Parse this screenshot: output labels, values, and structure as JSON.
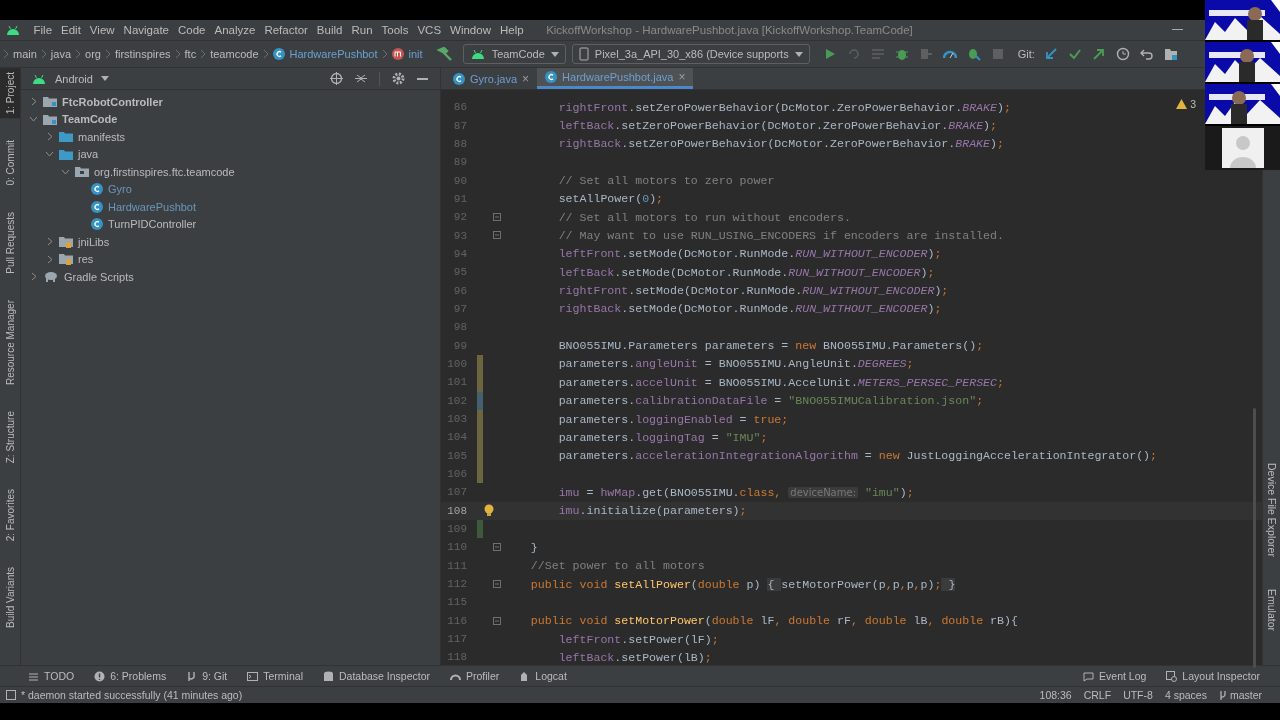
{
  "menu": [
    "File",
    "Edit",
    "View",
    "Navigate",
    "Code",
    "Analyze",
    "Refactor",
    "Build",
    "Run",
    "Tools",
    "VCS",
    "Window",
    "Help"
  ],
  "window": {
    "title": "KickoffWorkshop - HardwarePushbot.java [KickoffWorkshop.TeamCode]"
  },
  "breadcrumbs": [
    {
      "kind": "folder",
      "label": "main"
    },
    {
      "kind": "folder",
      "label": "java"
    },
    {
      "kind": "folder",
      "label": "org"
    },
    {
      "kind": "folder",
      "label": "firstinspires"
    },
    {
      "kind": "folder",
      "label": "ftc"
    },
    {
      "kind": "folder",
      "label": "teamcode"
    },
    {
      "kind": "class",
      "label": "HardwarePushbot"
    },
    {
      "kind": "method",
      "label": "init"
    }
  ],
  "run_config": "TeamCode",
  "device": "Pixel_3a_API_30_x86 (Device supports",
  "git_label": "Git:",
  "left_stripe": [
    {
      "label": "1: Project",
      "selected": true
    },
    {
      "label": "0: Commit",
      "selected": false
    },
    {
      "label": "Pull Requests",
      "selected": false
    },
    {
      "label": "Resource Manager",
      "selected": false
    },
    {
      "label": "Z: Structure",
      "selected": false
    },
    {
      "label": "2: Favorites",
      "selected": false
    },
    {
      "label": "Build Variants",
      "selected": false
    }
  ],
  "right_stripe": [
    "Device File Explorer",
    "Emulator"
  ],
  "project": {
    "view": "Android",
    "tree": [
      {
        "label": "FtcRobotController",
        "kind": "module",
        "expanded": false
      },
      {
        "label": "TeamCode",
        "kind": "module",
        "expanded": true,
        "children": [
          {
            "label": "manifests",
            "kind": "folder",
            "expanded": false
          },
          {
            "label": "java",
            "kind": "folder",
            "expanded": true,
            "children": [
              {
                "label": "org.firstinspires.ftc.teamcode",
                "kind": "package",
                "expanded": true,
                "children": [
                  {
                    "label": "Gyro",
                    "kind": "class",
                    "modified": true
                  },
                  {
                    "label": "HardwarePushbot",
                    "kind": "class",
                    "modified": true
                  },
                  {
                    "label": "TurnPIDController",
                    "kind": "class",
                    "modified": false
                  }
                ]
              }
            ]
          },
          {
            "label": "jniLibs",
            "kind": "resfolder",
            "expanded": false
          },
          {
            "label": "res",
            "kind": "resfolder",
            "expanded": false
          }
        ]
      },
      {
        "label": "Gradle Scripts",
        "kind": "gradle",
        "expanded": false
      }
    ]
  },
  "tabs": [
    {
      "label": "Gyro.java",
      "close": "×",
      "selected": false
    },
    {
      "label": "HardwarePushbot.java",
      "close": "×",
      "selected": true
    }
  ],
  "warnings": "3",
  "code": [
    {
      "number": "86",
      "tokens": [
        {
          "kind": "field",
          "text": "        rightFront"
        },
        {
          "kind": "plain",
          "text": ".setZeroPowerBehavior(DcMotor.ZeroPowerBehavior."
        },
        {
          "kind": "constant",
          "text": "BRAKE"
        },
        {
          "kind": "plain",
          "text": ")"
        },
        {
          "kind": "keyword",
          "text": ";"
        }
      ]
    },
    {
      "number": "87",
      "tokens": [
        {
          "kind": "field",
          "text": "        leftBack"
        },
        {
          "kind": "plain",
          "text": ".setZeroPowerBehavior(DcMotor.ZeroPowerBehavior."
        },
        {
          "kind": "constant",
          "text": "BRAKE"
        },
        {
          "kind": "plain",
          "text": ")"
        },
        {
          "kind": "keyword",
          "text": ";"
        }
      ]
    },
    {
      "number": "88",
      "tokens": [
        {
          "kind": "field",
          "text": "        rightBack"
        },
        {
          "kind": "plain",
          "text": ".setZeroPowerBehavior(DcMotor.ZeroPowerBehavior."
        },
        {
          "kind": "constant",
          "text": "BRAKE"
        },
        {
          "kind": "plain",
          "text": ")"
        },
        {
          "kind": "keyword",
          "text": ";"
        }
      ]
    },
    {
      "number": "89"
    },
    {
      "number": "90",
      "tokens": [
        {
          "kind": "comment",
          "text": "        // Set all motors to zero power"
        }
      ]
    },
    {
      "number": "91",
      "tokens": [
        {
          "kind": "plain",
          "text": "        setAllPower("
        },
        {
          "kind": "number",
          "text": "0"
        },
        {
          "kind": "plain",
          "text": ")"
        },
        {
          "kind": "keyword",
          "text": ";"
        }
      ]
    },
    {
      "number": "92",
      "fold": true,
      "tokens": [
        {
          "kind": "comment",
          "text": "        // Set all motors to run without encoders."
        }
      ]
    },
    {
      "number": "93",
      "fold": true,
      "tokens": [
        {
          "kind": "comment",
          "text": "        // May want to use RUN_USING_ENCODERS if encoders are installed."
        }
      ]
    },
    {
      "number": "94",
      "tokens": [
        {
          "kind": "field",
          "text": "        leftFront"
        },
        {
          "kind": "plain",
          "text": ".setMode(DcMotor.RunMode."
        },
        {
          "kind": "constant",
          "text": "RUN_WITHOUT_ENCODER"
        },
        {
          "kind": "plain",
          "text": ")"
        },
        {
          "kind": "keyword",
          "text": ";"
        }
      ]
    },
    {
      "number": "95",
      "tokens": [
        {
          "kind": "field",
          "text": "        leftBack"
        },
        {
          "kind": "plain",
          "text": ".setMode(DcMotor.RunMode."
        },
        {
          "kind": "constant",
          "text": "RUN_WITHOUT_ENCODER"
        },
        {
          "kind": "plain",
          "text": ")"
        },
        {
          "kind": "keyword",
          "text": ";"
        }
      ]
    },
    {
      "number": "96",
      "tokens": [
        {
          "kind": "field",
          "text": "        rightFront"
        },
        {
          "kind": "plain",
          "text": ".setMode(DcMotor.RunMode."
        },
        {
          "kind": "constant",
          "text": "RUN_WITHOUT_ENCODER"
        },
        {
          "kind": "plain",
          "text": ")"
        },
        {
          "kind": "keyword",
          "text": ";"
        }
      ]
    },
    {
      "number": "97",
      "tokens": [
        {
          "kind": "field",
          "text": "        rightBack"
        },
        {
          "kind": "plain",
          "text": ".setMode(DcMotor.RunMode."
        },
        {
          "kind": "constant",
          "text": "RUN_WITHOUT_ENCODER"
        },
        {
          "kind": "plain",
          "text": ")"
        },
        {
          "kind": "keyword",
          "text": ";"
        }
      ]
    },
    {
      "number": "98"
    },
    {
      "number": "99",
      "tokens": [
        {
          "kind": "plain",
          "text": "        BNO055IMU.Parameters parameters = "
        },
        {
          "kind": "keyword",
          "text": "new"
        },
        {
          "kind": "plain",
          "text": " BNO055IMU.Parameters()"
        },
        {
          "kind": "keyword",
          "text": ";"
        }
      ]
    },
    {
      "number": "100",
      "color": "#6f6440",
      "tokens": [
        {
          "kind": "plain",
          "text": "        parameters."
        },
        {
          "kind": "field",
          "text": "angleUnit"
        },
        {
          "kind": "plain",
          "text": " = BNO055IMU.AngleUnit."
        },
        {
          "kind": "constant",
          "text": "DEGREES"
        },
        {
          "kind": "keyword",
          "text": ";"
        }
      ]
    },
    {
      "number": "101",
      "color": "#6f6440",
      "tokens": [
        {
          "kind": "plain",
          "text": "        parameters."
        },
        {
          "kind": "field",
          "text": "accelUnit"
        },
        {
          "kind": "plain",
          "text": " = BNO055IMU.AccelUnit."
        },
        {
          "kind": "constant",
          "text": "METERS_PERSEC_PERSEC"
        },
        {
          "kind": "keyword",
          "text": ";"
        }
      ]
    },
    {
      "number": "102",
      "color": "#45606d",
      "tokens": [
        {
          "kind": "plain",
          "text": "        parameters."
        },
        {
          "kind": "field",
          "text": "calibrationDataFile"
        },
        {
          "kind": "plain",
          "text": " = "
        },
        {
          "kind": "string",
          "text": "\"BNO055IMUCalibration.json\""
        },
        {
          "kind": "keyword",
          "text": ";"
        }
      ]
    },
    {
      "number": "103",
      "color": "#6f6440",
      "tokens": [
        {
          "kind": "plain",
          "text": "        parameters."
        },
        {
          "kind": "field",
          "text": "loggingEnabled"
        },
        {
          "kind": "plain",
          "text": " = "
        },
        {
          "kind": "keyword",
          "text": "true;"
        }
      ]
    },
    {
      "number": "104",
      "color": "#6f6440",
      "tokens": [
        {
          "kind": "plain",
          "text": "        parameters."
        },
        {
          "kind": "field",
          "text": "loggingTag"
        },
        {
          "kind": "plain",
          "text": " = "
        },
        {
          "kind": "string",
          "text": "\"IMU\""
        },
        {
          "kind": "keyword",
          "text": ";"
        }
      ]
    },
    {
      "number": "105",
      "color": "#6f6440",
      "tokens": [
        {
          "kind": "plain",
          "text": "        parameters."
        },
        {
          "kind": "field",
          "text": "accelerationIntegrationAlgorithm"
        },
        {
          "kind": "plain",
          "text": " = "
        },
        {
          "kind": "keyword",
          "text": "new"
        },
        {
          "kind": "plain",
          "text": " JustLoggingAccelerationIntegrator()"
        },
        {
          "kind": "keyword",
          "text": ";"
        }
      ]
    },
    {
      "number": "106",
      "color": "#6f6440"
    },
    {
      "number": "107",
      "tokens": [
        {
          "kind": "field",
          "text": "        imu"
        },
        {
          "kind": "plain",
          "text": " = "
        },
        {
          "kind": "field",
          "text": "hwMap"
        },
        {
          "kind": "plain",
          "text": ".get(BNO055IMU."
        },
        {
          "kind": "keyword",
          "text": "class, "
        },
        {
          "kind": "hint",
          "text": "deviceName:"
        },
        {
          "kind": "string",
          "text": " \"imu\""
        },
        {
          "kind": "plain",
          "text": ")"
        },
        {
          "kind": "keyword",
          "text": ";"
        }
      ]
    },
    {
      "number": "108",
      "current": true,
      "tokens": [
        {
          "kind": "field",
          "text": "        imu"
        },
        {
          "kind": "plain",
          "text": ".initialize(parameters)"
        },
        {
          "kind": "keyword",
          "text": ";"
        }
      ]
    },
    {
      "number": "109",
      "color": "#3d5a3d"
    },
    {
      "number": "110",
      "fold": true,
      "tokens": [
        {
          "kind": "plain",
          "text": "    }"
        }
      ]
    },
    {
      "number": "111",
      "tokens": [
        {
          "kind": "comment",
          "text": "    //Set power to all motors"
        }
      ]
    },
    {
      "number": "112",
      "fold": true,
      "tokens": [
        {
          "kind": "keyword",
          "text": "    public void "
        },
        {
          "kind": "declaration",
          "text": "setAllPower"
        },
        {
          "kind": "plain",
          "text": "("
        },
        {
          "kind": "keyword",
          "text": "double"
        },
        {
          "kind": "plain",
          "text": " p) "
        },
        {
          "kind": "folded",
          "text": "{ "
        },
        {
          "kind": "plain",
          "text": "setMotorPower(p"
        },
        {
          "kind": "keyword",
          "text": ","
        },
        {
          "kind": "plain",
          "text": "p"
        },
        {
          "kind": "keyword",
          "text": ","
        },
        {
          "kind": "plain",
          "text": "p"
        },
        {
          "kind": "keyword",
          "text": ","
        },
        {
          "kind": "plain",
          "text": "p)"
        },
        {
          "kind": "keyword",
          "text": ";"
        },
        {
          "kind": "folded",
          "text": " }"
        }
      ]
    },
    {
      "number": "115"
    },
    {
      "number": "116",
      "fold": true,
      "tokens": [
        {
          "kind": "keyword",
          "text": "    public void "
        },
        {
          "kind": "declaration",
          "text": "setMotorPower"
        },
        {
          "kind": "plain",
          "text": "("
        },
        {
          "kind": "keyword",
          "text": "double"
        },
        {
          "kind": "plain",
          "text": " lF"
        },
        {
          "kind": "keyword",
          "text": ", double"
        },
        {
          "kind": "plain",
          "text": " rF"
        },
        {
          "kind": "keyword",
          "text": ", double"
        },
        {
          "kind": "plain",
          "text": " lB"
        },
        {
          "kind": "keyword",
          "text": ", double"
        },
        {
          "kind": "plain",
          "text": " rB){"
        }
      ]
    },
    {
      "number": "117",
      "tokens": [
        {
          "kind": "field",
          "text": "        leftFront"
        },
        {
          "kind": "plain",
          "text": ".setPower(lF)"
        },
        {
          "kind": "keyword",
          "text": ";"
        }
      ]
    },
    {
      "number": "118",
      "tokens": [
        {
          "kind": "field",
          "text": "        leftBack"
        },
        {
          "kind": "plain",
          "text": ".setPower(lB)"
        },
        {
          "kind": "keyword",
          "text": ";"
        }
      ]
    }
  ],
  "bottom_tools": [
    {
      "kind": "todo",
      "label": "TODO"
    },
    {
      "kind": "problems",
      "label": "6: Problems"
    },
    {
      "kind": "git",
      "label": "9: Git"
    },
    {
      "kind": "terminal",
      "label": "Terminal"
    },
    {
      "kind": "database",
      "label": "Database Inspector"
    },
    {
      "kind": "profiler",
      "label": "Profiler"
    },
    {
      "kind": "logcat",
      "label": "Logcat"
    }
  ],
  "bottom_tools_right": [
    {
      "kind": "eventlog",
      "label": "Event Log"
    },
    {
      "kind": "layout",
      "label": "Layout Inspector"
    }
  ],
  "status": {
    "message": "* daemon started successfully (41 minutes ago)",
    "position": "108:36",
    "line_ending": "CRLF",
    "encoding": "UTF-8",
    "indent": "4 spaces",
    "branch": "master"
  },
  "video_overlay": [
    {
      "kind": "picture"
    },
    {
      "kind": "picture"
    },
    {
      "kind": "picture"
    },
    {
      "kind": "avatar"
    }
  ]
}
